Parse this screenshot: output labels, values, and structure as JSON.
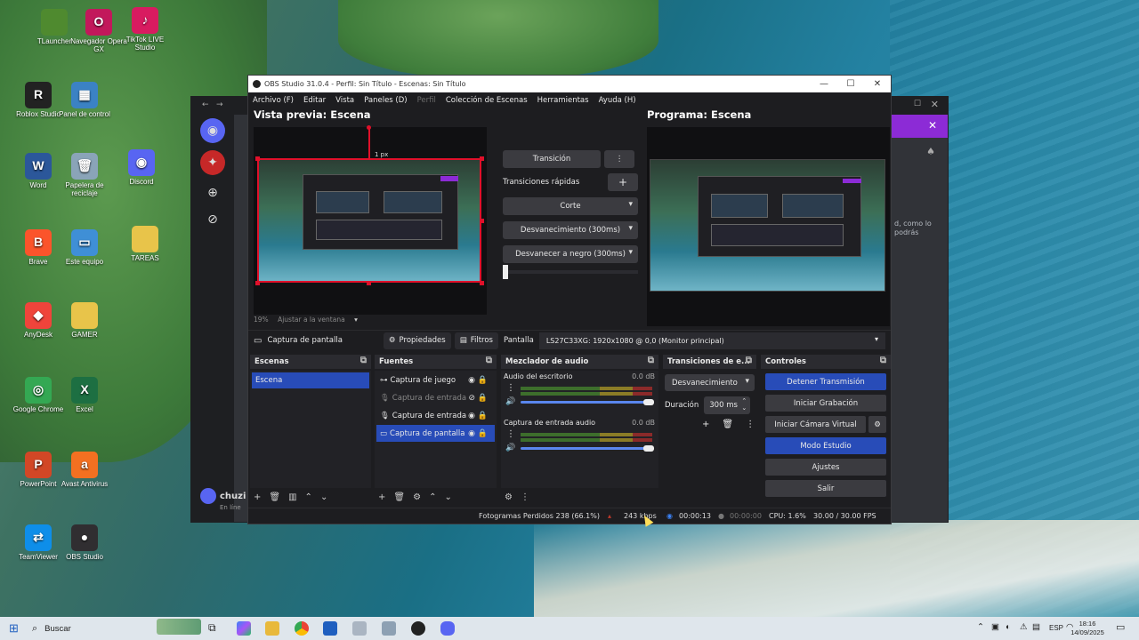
{
  "desktop": {
    "icons": [
      {
        "label": "TLauncher",
        "letter": "",
        "color": "#4f8a2f",
        "icon": "tlauncher-icon"
      },
      {
        "label": "Navegador Opera GX",
        "letter": "O",
        "color": "#c2185b",
        "icon": "opera-gx-icon"
      },
      {
        "label": "TikTok LIVE Studio",
        "letter": "♪",
        "color": "#d81b60",
        "icon": "tiktok-icon"
      },
      {
        "label": "Roblox Studio",
        "letter": "R",
        "color": "#222222",
        "icon": "roblox-icon"
      },
      {
        "label": "Panel de control",
        "letter": "▦",
        "color": "#3b82c4",
        "icon": "control-panel-icon"
      },
      {
        "label": "Word",
        "letter": "W",
        "color": "#2b579a",
        "icon": "word-icon"
      },
      {
        "label": "Papelera de reciclaje",
        "letter": "🗑",
        "color": "#8aa4b8",
        "icon": "recycle-bin-icon"
      },
      {
        "label": "Discord",
        "letter": "◉",
        "color": "#5865f2",
        "icon": "discord-icon"
      },
      {
        "label": "Brave",
        "letter": "B",
        "color": "#fb542b",
        "icon": "brave-icon"
      },
      {
        "label": "Este equipo",
        "letter": "▭",
        "color": "#3f8fd6",
        "icon": "this-pc-icon"
      },
      {
        "label": "TAREAS",
        "letter": "",
        "color": "#e8c44a",
        "icon": "folder-icon"
      },
      {
        "label": "AnyDesk",
        "letter": "◆",
        "color": "#ef443b",
        "icon": "anydesk-icon"
      },
      {
        "label": "GAMER",
        "letter": "",
        "color": "#e8c44a",
        "icon": "folder-icon"
      },
      {
        "label": "Google Chrome",
        "letter": "◎",
        "color": "#34a853",
        "icon": "chrome-icon"
      },
      {
        "label": "Excel",
        "letter": "X",
        "color": "#1d6f42",
        "icon": "excel-icon"
      },
      {
        "label": "PowerPoint",
        "letter": "P",
        "color": "#d24726",
        "icon": "powerpoint-icon"
      },
      {
        "label": "Avast Antivirus",
        "letter": "a",
        "color": "#f37021",
        "icon": "avast-icon"
      },
      {
        "label": "TeamViewer",
        "letter": "⇄",
        "color": "#0e8ee9",
        "icon": "teamviewer-icon"
      },
      {
        "label": "OBS Studio",
        "letter": "●",
        "color": "#302e31",
        "icon": "obs-icon"
      }
    ]
  },
  "discord": {
    "hint": "d, como lo podrás",
    "user": "chuzi",
    "user_status": "En líne"
  },
  "obs": {
    "title": "OBS Studio 31.0.4 - Perfil: Sin Título - Escenas: Sin Título",
    "menu": [
      "Archivo (F)",
      "Editar",
      "Vista",
      "Paneles (D)",
      "Perfil",
      "Colección de Escenas",
      "Herramientas",
      "Ayuda (H)"
    ],
    "preview_title": "Vista previa: Escena",
    "program_title": "Programa: Escena",
    "px_label": "1 px",
    "zoom": "19%",
    "zoom_mode": "Ajustar a la ventana",
    "transition_button": "Transición",
    "quick_transitions": "Transiciones rápidas",
    "transitions": [
      "Corte",
      "Desvanecimiento (300ms)",
      "Desvanecer a negro (300ms)"
    ],
    "selected_source": "Captura de pantalla",
    "properties": "Propiedades",
    "filters": "Filtros",
    "display_label": "Pantalla",
    "display_value": "LS27C33XG: 1920x1080 @ 0,0 (Monitor principal)",
    "docks": {
      "scenes": {
        "title": "Escenas",
        "items": [
          "Escena"
        ]
      },
      "sources": {
        "title": "Fuentes",
        "items": [
          {
            "name": "Captura de juego",
            "icon": "gamepad-icon",
            "dim": false,
            "selected": false
          },
          {
            "name": "Captura de entrada",
            "icon": "mic-icon",
            "dim": true,
            "selected": false
          },
          {
            "name": "Captura de entrada",
            "icon": "mic-icon",
            "dim": false,
            "selected": false
          },
          {
            "name": "Captura de pantalla",
            "icon": "monitor-icon",
            "dim": false,
            "selected": true
          }
        ]
      },
      "mixer": {
        "title": "Mezclador de audio",
        "channels": [
          {
            "name": "Audio del escritorio",
            "db": "0.0 dB",
            "level": 1.0
          },
          {
            "name": "Captura de entrada audio",
            "db": "0.0 dB",
            "level": 1.0
          }
        ]
      },
      "transitions": {
        "title": "Transiciones de e...",
        "current": "Desvanecimiento",
        "duration_label": "Duración",
        "duration_value": "300 ms"
      },
      "controls": {
        "title": "Controles",
        "buttons": [
          "Detener Transmisión",
          "Iniciar Grabación",
          "Iniciar Cámara Virtual",
          "Modo Estudio",
          "Ajustes",
          "Salir"
        ]
      }
    },
    "status": {
      "dropped": "Fotogramas Perdidos 238 (66.1%)",
      "bitrate": "243 kbps",
      "stream_time": "00:00:13",
      "rec_time": "00:00:00",
      "cpu": "CPU: 1.6%",
      "fps": "30.00 / 30.00 FPS"
    }
  },
  "taskbar": {
    "search": "Buscar",
    "lang": "ESP",
    "time": "18:16",
    "date": "14/09/2025"
  }
}
